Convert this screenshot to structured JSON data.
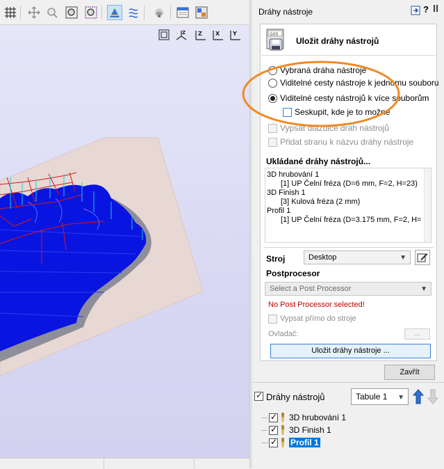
{
  "toolbar": {
    "buttons": [
      "grid-icon",
      "pan-icon",
      "zoom-icon",
      "zoom-box-icon",
      "zoom-selection-icon",
      "toolpath-view-icon",
      "toolpath-alt-icon",
      "shade-icon",
      "layout-icon",
      "layers-icon"
    ]
  },
  "view_icons": {
    "fit": "fit-view-icon",
    "iso": "Z",
    "axis_z": "Z",
    "axis_x": "X",
    "axis_y": "Y"
  },
  "panel": {
    "title": "Dráhy nástroje",
    "help": "?",
    "save_header": "Uložit dráhy nástrojů",
    "options": {
      "selected": "Vybraná dráha nástroje",
      "single_file": "Viditelné cesty nástroje k jednomu souboru",
      "multi_file": "Viditelné cesty nástrojů k více souborům",
      "group": "Seskupit, kde je to možné",
      "write_tiles": "Vypsat dlaždice drah nástrojů",
      "add_side": "Přidat stranu k názvu dráhy nástroje"
    },
    "saved_title": "Ukládané dráhy nástrojů...",
    "saved_lines": [
      "3D hrubování 1",
      "[1] UP Čelní fréza (D=6 mm, F=2, H=23)",
      "3D Finish 1",
      "[3] Kulová fréza (2 mm)",
      "Profil 1",
      "[1] UP Čelní fréza (D=3.175 mm, F=2, H="
    ],
    "machine_label": "Stroj",
    "machine_value": "Desktop",
    "post_label": "Postprocesor",
    "post_placeholder": "Select a Post Processor",
    "post_error": "No Post Processor selected!",
    "write_direct": "Vypsat přímo do stroje",
    "controller_label": "Ovladač:",
    "controller_btn": "...",
    "save_button": "Uložit dráhy nástroje ...",
    "close_button": "Zavřít"
  },
  "toolpaths": {
    "title": "Dráhy nástrojů",
    "sheet": "Tabule 1",
    "items": [
      "3D hrubování 1",
      "3D Finish 1",
      "Profil 1"
    ]
  },
  "colors": {
    "highlight_oval": "#f08a24",
    "selection": "#0078d7",
    "toolpath_blue": "#0a14e0",
    "error": "#c00000"
  }
}
